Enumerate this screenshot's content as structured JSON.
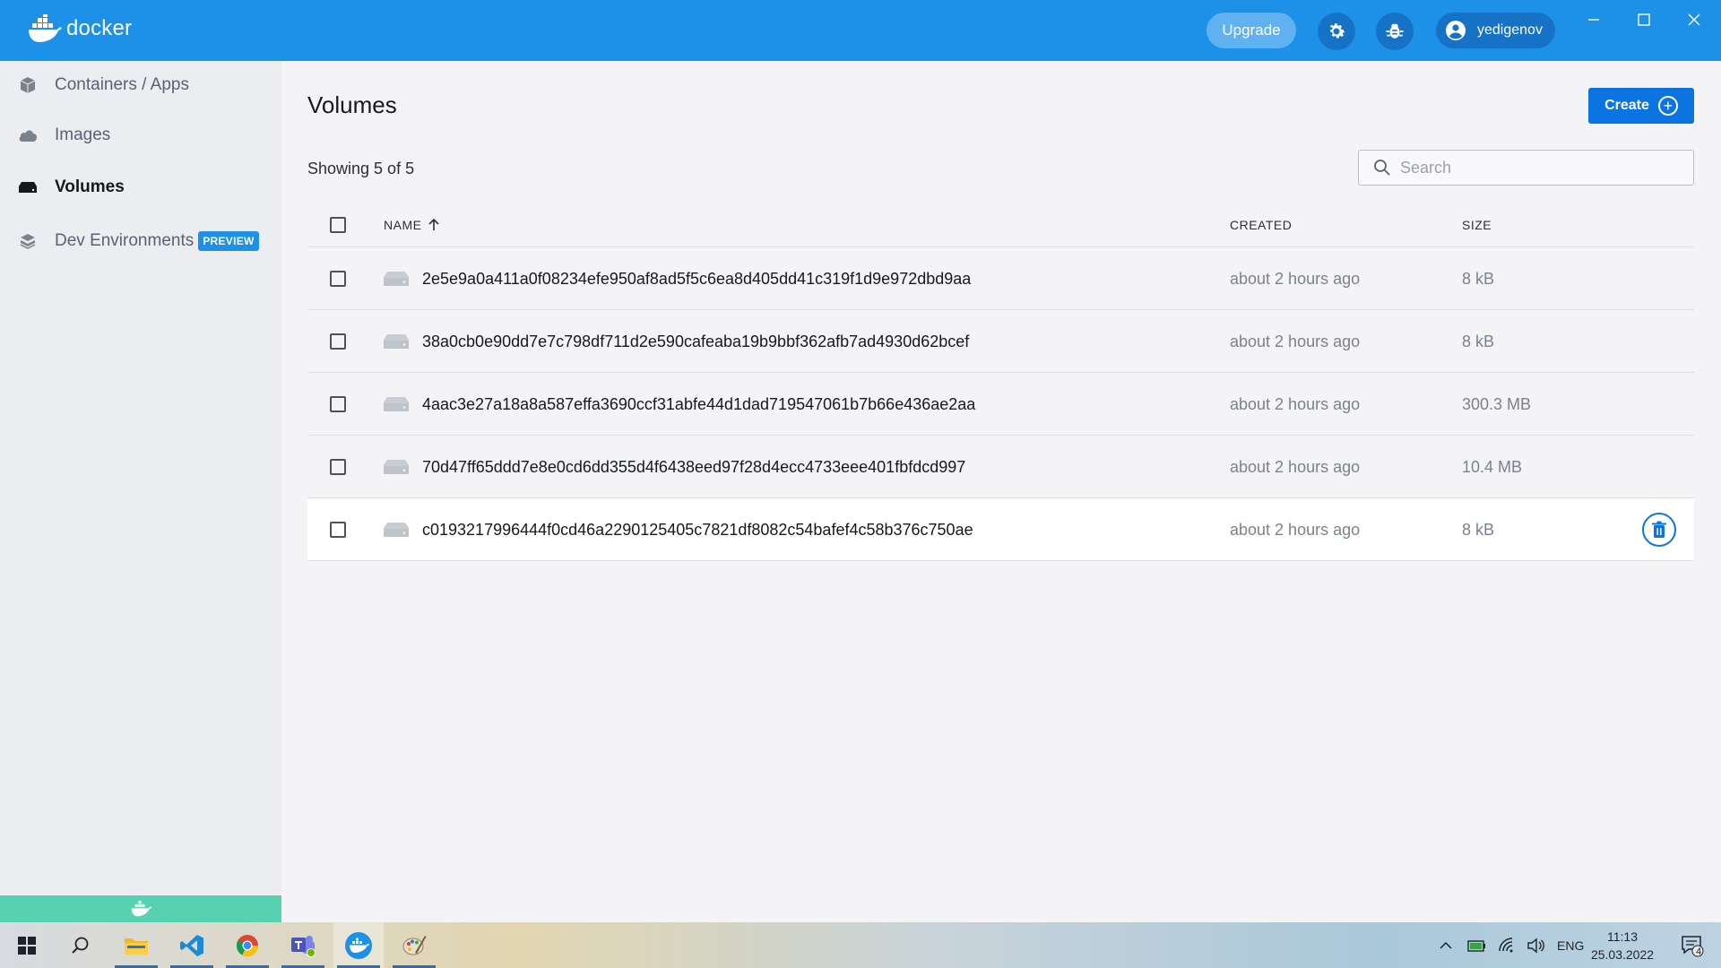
{
  "header": {
    "app_name": "docker",
    "upgrade_label": "Upgrade",
    "username": "yedigenov"
  },
  "sidebar": {
    "items": [
      {
        "label": "Containers / Apps",
        "icon": "cube-icon"
      },
      {
        "label": "Images",
        "icon": "cloud-icon"
      },
      {
        "label": "Volumes",
        "icon": "hard-drive-icon",
        "active": true
      },
      {
        "label": "Dev Environments",
        "icon": "layers-icon",
        "badge": "PREVIEW"
      }
    ]
  },
  "main": {
    "title": "Volumes",
    "create_label": "Create",
    "showing_text": "Showing 5 of 5",
    "search_placeholder": "Search",
    "columns": {
      "name": "NAME",
      "created": "CREATED",
      "size": "SIZE"
    },
    "rows": [
      {
        "name": "2e5e9a0a411a0f08234efe950af8ad5f5c6ea8d405dd41c319f1d9e972dbd9aa",
        "created": "about 2 hours ago",
        "size": "8 kB"
      },
      {
        "name": "38a0cb0e90dd7e7c798df711d2e590cafeaba19b9bbf362afb7ad4930d62bcef",
        "created": "about 2 hours ago",
        "size": "8 kB"
      },
      {
        "name": "4aac3e27a18a8a587effa3690ccf31abfe44d1dad719547061b7b66e436ae2aa",
        "created": "about 2 hours ago",
        "size": "300.3 MB"
      },
      {
        "name": "70d47ff65ddd7e8e0cd6dd355d4f6438eed97f28d4ecc4733eee401fbfdcd997",
        "created": "about 2 hours ago",
        "size": "10.4 MB"
      },
      {
        "name": "c0193217996444f0cd46a2290125405c7821df8082c54bafef4c58b376c750ae",
        "created": "about 2 hours ago",
        "size": "8 kB"
      }
    ]
  },
  "taskbar": {
    "language": "ENG",
    "time": "11:13",
    "date": "25.03.2022",
    "notification_count": "4"
  },
  "colors": {
    "brand_blue": "#1d91e8",
    "primary_button": "#0c74e0",
    "status_green": "#58d1b1"
  }
}
